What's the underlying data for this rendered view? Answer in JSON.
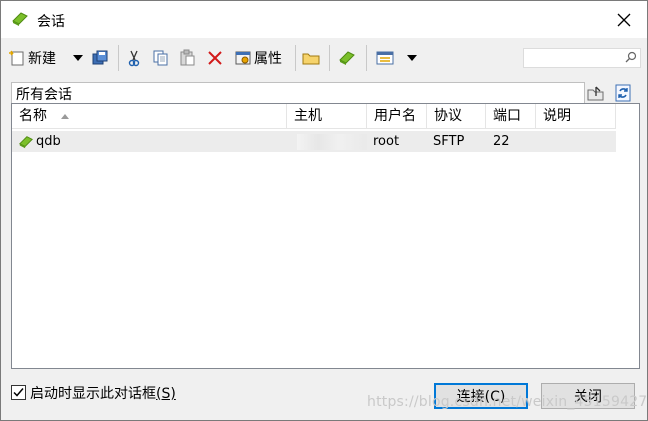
{
  "window": {
    "title": "会话"
  },
  "toolbar": {
    "new_label": "新建",
    "properties_label": "属性",
    "search": {
      "value": "",
      "placeholder": ""
    }
  },
  "path": {
    "label": "所有会话"
  },
  "list": {
    "columns": [
      "名称",
      "主机",
      "用户名",
      "协议",
      "端口",
      "说明"
    ],
    "rows": [
      {
        "name": "qdb",
        "host": "",
        "user": "root",
        "protocol": "SFTP",
        "port": "22",
        "description": ""
      }
    ]
  },
  "footer": {
    "startup_checkbox_label": "启动时显示此对话框",
    "startup_checkbox_accel": "(S)",
    "startup_checked": true,
    "connect_label": "连接(C)",
    "close_label": "关闭"
  },
  "watermark": "https://blog.csdn.net/weixin_45159427",
  "colors": {
    "accent": "#0078d7",
    "session_icon": "#7bbf2a"
  }
}
